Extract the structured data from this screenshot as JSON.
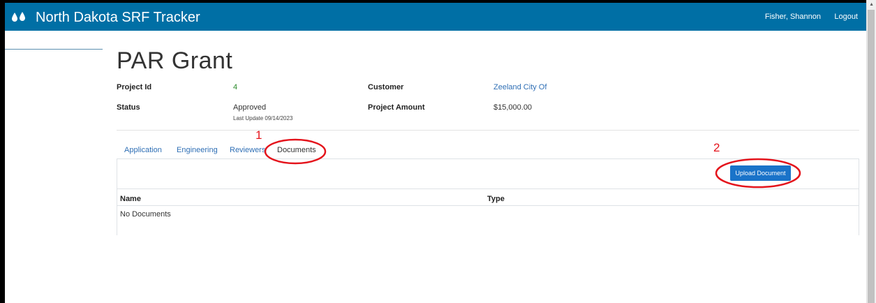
{
  "navbar": {
    "title": "North Dakota SRF Tracker",
    "brand_icon": "water-drops-icon",
    "user": "Fisher, Shannon",
    "logout": "Logout",
    "color": "#006fa5"
  },
  "page": {
    "title": "PAR Grant"
  },
  "details": {
    "project_id_label": "Project Id",
    "project_id_value": "4",
    "customer_label": "Customer",
    "customer_value": "Zeeland City Of",
    "status_label": "Status",
    "status_value": "Approved",
    "status_updated": "Last Update 09/14/2023",
    "amount_label": "Project Amount",
    "amount_value": "$15,000.00"
  },
  "tabs": [
    {
      "label": "Application",
      "active": false
    },
    {
      "label": "Engineering",
      "active": false
    },
    {
      "label": "Reviewers",
      "active": false
    },
    {
      "label": "Documents",
      "active": true
    }
  ],
  "documents": {
    "upload_label": "Upload Document",
    "columns": [
      "Name",
      "Type"
    ],
    "empty_text": "No Documents"
  },
  "annotations": {
    "step1": "1",
    "step2": "2",
    "color": "#e4141c"
  }
}
